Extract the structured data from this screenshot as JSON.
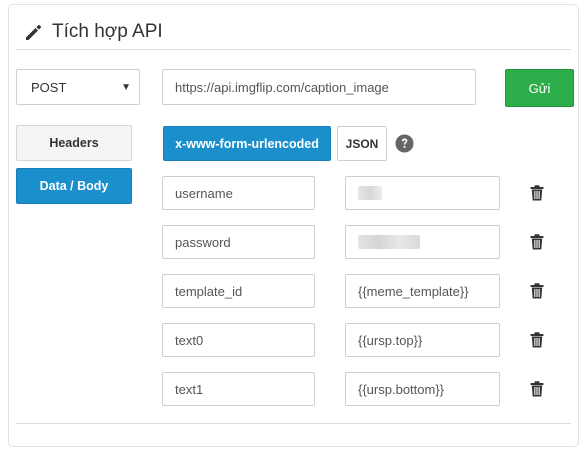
{
  "panel": {
    "title": "Tích hợp API"
  },
  "request": {
    "method": "POST",
    "url": "https://api.imgflip.com/caption_image",
    "send_label": "Gửi"
  },
  "sidebar": {
    "headers_label": "Headers",
    "body_label": "Data / Body"
  },
  "body_tabs": {
    "urlencoded_label": "x-www-form-urlencoded",
    "json_label": "JSON"
  },
  "params": [
    {
      "key": "username",
      "value": ""
    },
    {
      "key": "password",
      "value": ""
    },
    {
      "key": "template_id",
      "value": "{{meme_template}}"
    },
    {
      "key": "text0",
      "value": "{{ursp.top}}"
    },
    {
      "key": "text1",
      "value": "{{ursp.bottom}}"
    }
  ],
  "colors": {
    "primary": "#1b8fcc",
    "success": "#2eae4b"
  }
}
